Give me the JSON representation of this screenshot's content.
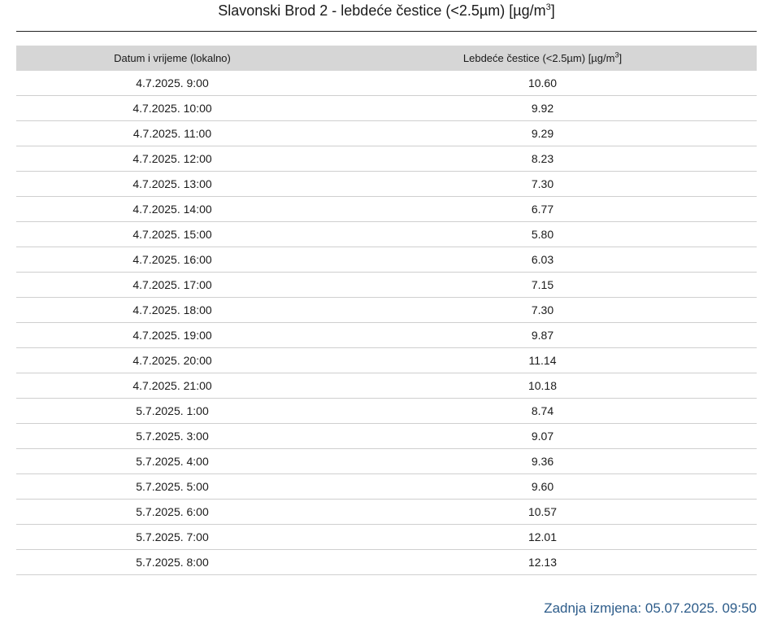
{
  "title": {
    "text": "Slavonski Brod 2 - lebdeće čestice (<2.5µm) [µg/m",
    "superscript": "3",
    "suffix": "]"
  },
  "table": {
    "headers": {
      "date": "Datum i vrijeme (lokalno)",
      "value_text": "Lebdeće čestice (<2.5µm) [µg/m",
      "value_superscript": "3",
      "value_suffix": "]"
    },
    "rows": [
      {
        "datetime": "4.7.2025. 9:00",
        "value": "10.60"
      },
      {
        "datetime": "4.7.2025. 10:00",
        "value": "9.92"
      },
      {
        "datetime": "4.7.2025. 11:00",
        "value": "9.29"
      },
      {
        "datetime": "4.7.2025. 12:00",
        "value": "8.23"
      },
      {
        "datetime": "4.7.2025. 13:00",
        "value": "7.30"
      },
      {
        "datetime": "4.7.2025. 14:00",
        "value": "6.77"
      },
      {
        "datetime": "4.7.2025. 15:00",
        "value": "5.80"
      },
      {
        "datetime": "4.7.2025. 16:00",
        "value": "6.03"
      },
      {
        "datetime": "4.7.2025. 17:00",
        "value": "7.15"
      },
      {
        "datetime": "4.7.2025. 18:00",
        "value": "7.30"
      },
      {
        "datetime": "4.7.2025. 19:00",
        "value": "9.87"
      },
      {
        "datetime": "4.7.2025. 20:00",
        "value": "11.14"
      },
      {
        "datetime": "4.7.2025. 21:00",
        "value": "10.18"
      },
      {
        "datetime": "5.7.2025. 1:00",
        "value": "8.74"
      },
      {
        "datetime": "5.7.2025. 3:00",
        "value": "9.07"
      },
      {
        "datetime": "5.7.2025. 4:00",
        "value": "9.36"
      },
      {
        "datetime": "5.7.2025. 5:00",
        "value": "9.60"
      },
      {
        "datetime": "5.7.2025. 6:00",
        "value": "10.57"
      },
      {
        "datetime": "5.7.2025. 7:00",
        "value": "12.01"
      },
      {
        "datetime": "5.7.2025. 8:00",
        "value": "12.13"
      }
    ]
  },
  "footer": {
    "last_modified": "Zadnja izmjena: 05.07.2025. 09:50"
  },
  "colors": {
    "header_bg": "#d6d6d6",
    "footer_text": "#2d5c8a",
    "row_border": "#cfcfcf"
  }
}
